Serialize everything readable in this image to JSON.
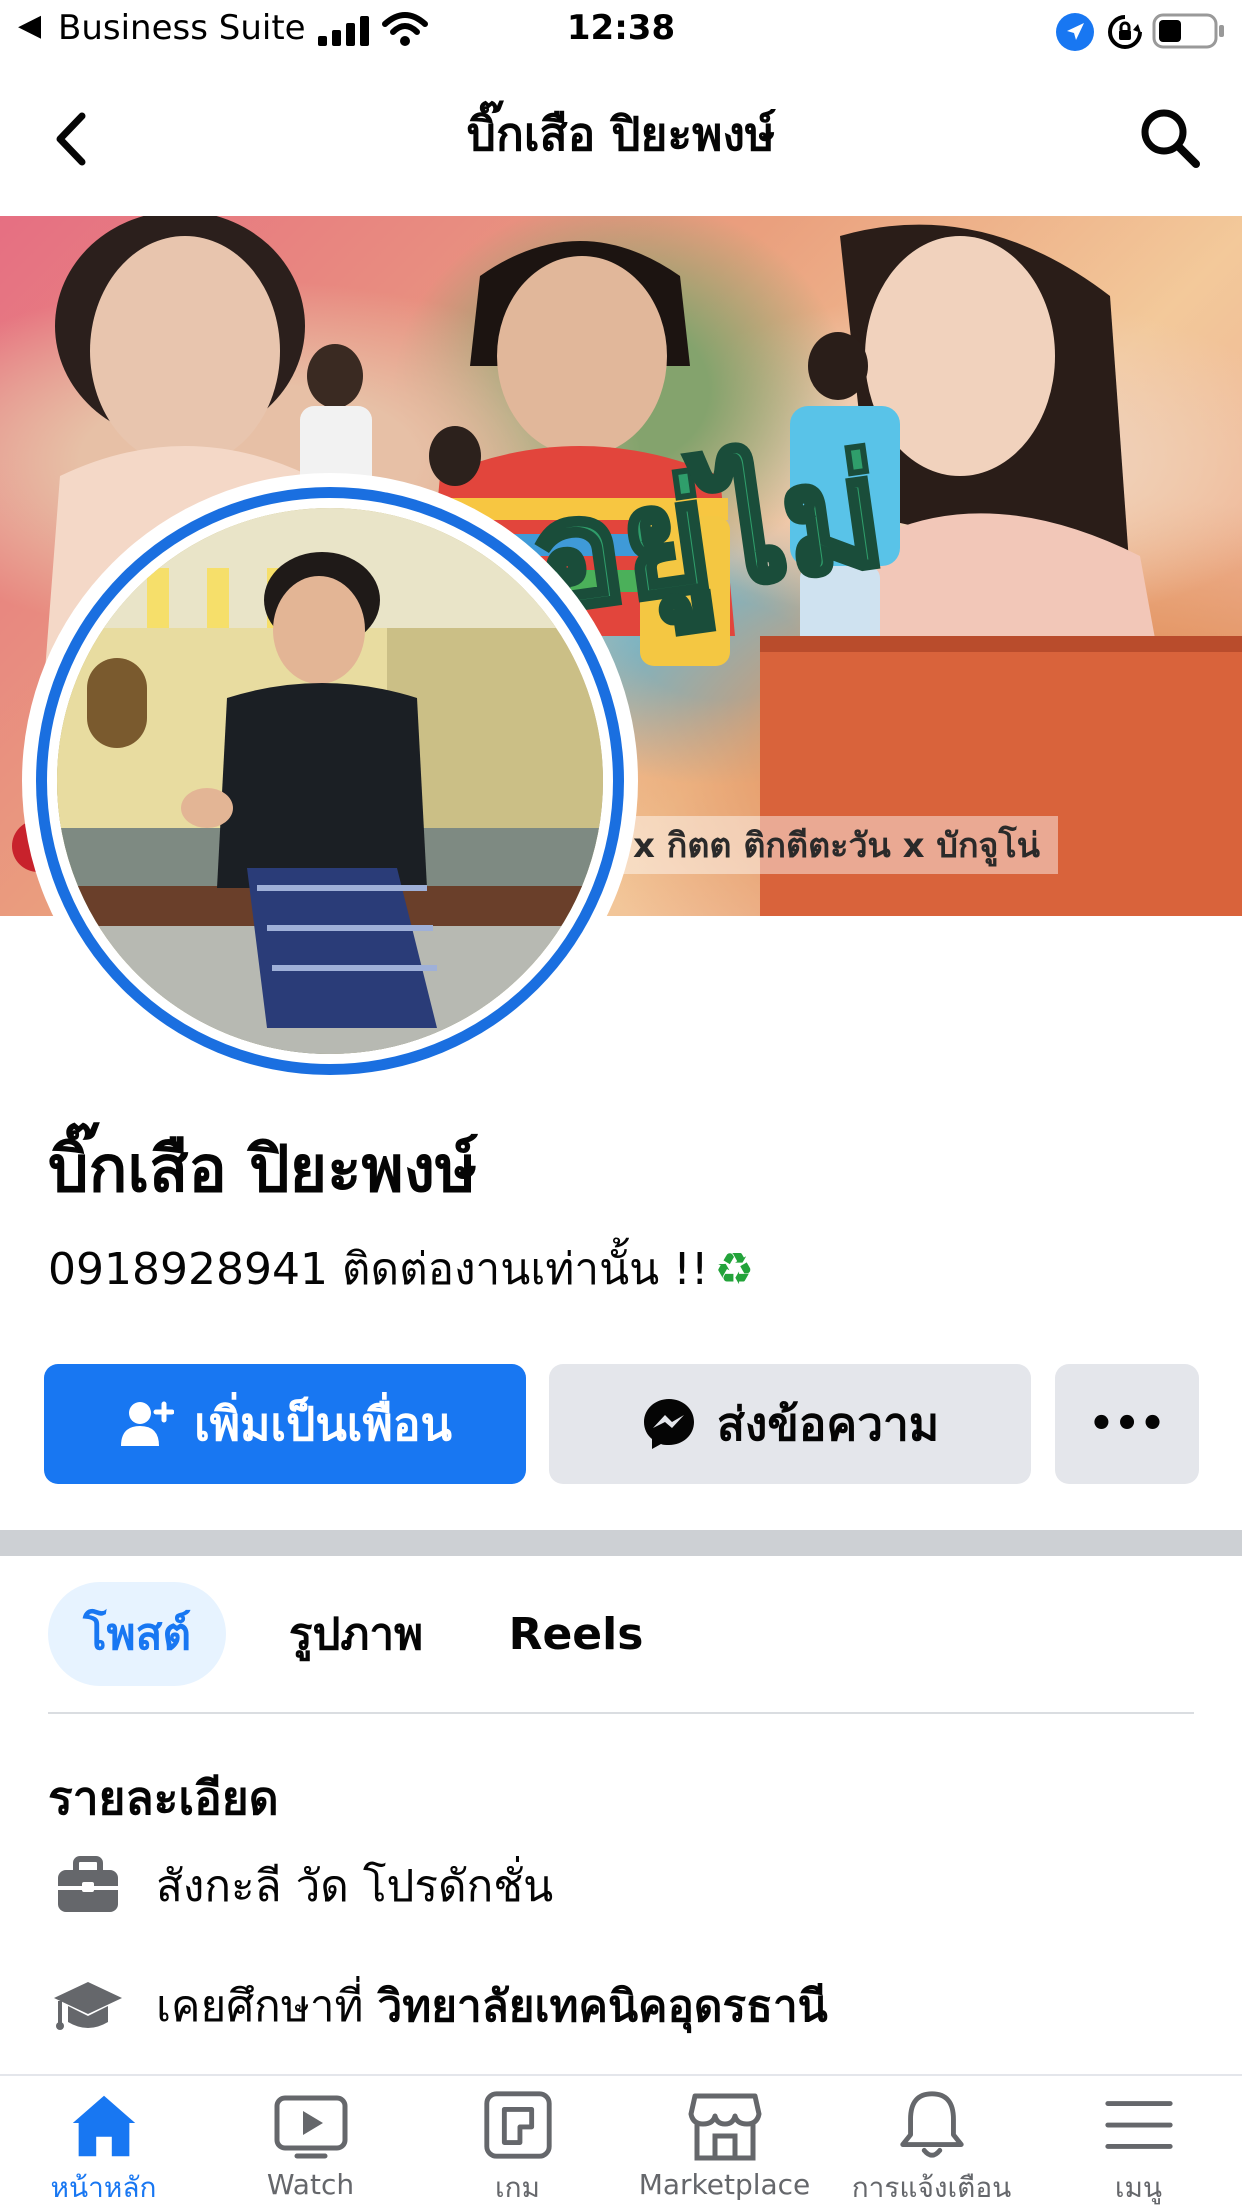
{
  "status_bar": {
    "back_app": "Business Suite",
    "time": "12:38"
  },
  "header": {
    "title": "บิ๊กเสือ ปิยะพงษ์"
  },
  "cover": {
    "credit_text": "x กิตต ติกตีตะวัน x บักจูโน่"
  },
  "profile": {
    "name": "บิ๊กเสือ ปิยะพงษ์",
    "bio": "0918928941 ติดต่องานเท่านั้น !!",
    "bio_emoji": "♻"
  },
  "actions": {
    "add_friend_label": "เพิ่มเป็นเพื่อน",
    "message_label": "ส่งข้อความ",
    "more_label": "•••"
  },
  "tabs": [
    {
      "label": "โพสต์",
      "active": true
    },
    {
      "label": "รูปภาพ",
      "active": false
    },
    {
      "label": "Reels",
      "active": false
    }
  ],
  "details": {
    "heading": "รายละเอียด",
    "work": "สังกะลี วัด โปรดักชั่น",
    "education_prefix": "เคยศึกษาที่",
    "education_school": "วิทยาลัยเทคนิคอุดรธานี"
  },
  "bottom_nav": [
    {
      "label": "หน้าหลัก",
      "icon": "home-icon",
      "active": true
    },
    {
      "label": "Watch",
      "icon": "watch-icon",
      "active": false
    },
    {
      "label": "เกม",
      "icon": "gaming-icon",
      "active": false
    },
    {
      "label": "Marketplace",
      "icon": "marketplace-icon",
      "active": false
    },
    {
      "label": "การแจ้งเตือน",
      "icon": "bell-icon",
      "active": false
    },
    {
      "label": "เมนู",
      "icon": "menu-icon",
      "active": false
    }
  ],
  "colors": {
    "accent": "#1877f2",
    "button_gray": "#e4e6eb",
    "divider": "#cdd0d4",
    "text": "#050505"
  }
}
